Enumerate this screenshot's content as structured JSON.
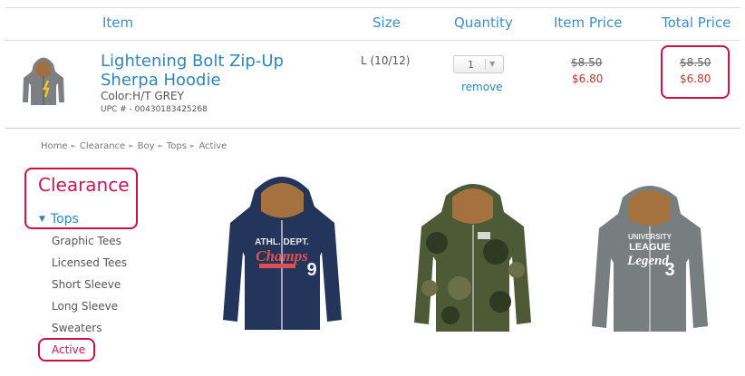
{
  "cart": {
    "headers": {
      "item": "Item",
      "size": "Size",
      "quantity": "Quantity",
      "item_price": "Item Price",
      "total_price": "Total Price"
    },
    "product": {
      "name": "Lightening Bolt Zip-Up Sherpa Hoodie",
      "color": "Color:H/T GREY",
      "upc": "UPC # - 00430183425268",
      "size": "L (10/12)",
      "quantity": "1",
      "remove": "remove",
      "item_price_original": "$8.50",
      "item_price_sale": "$6.80",
      "total_price_original": "$8.50",
      "total_price_sale": "$6.80"
    }
  },
  "breadcrumb": [
    "Home",
    "Clearance",
    "Boy",
    "Tops",
    "Active"
  ],
  "sidebar": {
    "heading": "Clearance",
    "category": "Tops",
    "items": [
      "Graphic Tees",
      "Licensed Tees",
      "Short Sleeve",
      "Long Sleeve",
      "Sweaters",
      "Active"
    ]
  },
  "products": [
    {
      "text1": "ATHL. DEPT.",
      "text2": "Champs",
      "number": "9",
      "colors": {
        "body": "#23355a",
        "text": "#e05050"
      }
    },
    {
      "text1": "",
      "text2": "",
      "number": "",
      "colors": {
        "body": "#4d5a35",
        "text": "#ffffff"
      }
    },
    {
      "text1": "UNIVERSITY",
      "text2": "LEAGUE",
      "text3": "Legend",
      "number": "3",
      "colors": {
        "body": "#787d80",
        "text": "#ffffff"
      }
    }
  ],
  "thumbnail": {
    "text": "",
    "colors": {
      "body": "#7d7f82",
      "bolt": "#f2c230"
    }
  }
}
